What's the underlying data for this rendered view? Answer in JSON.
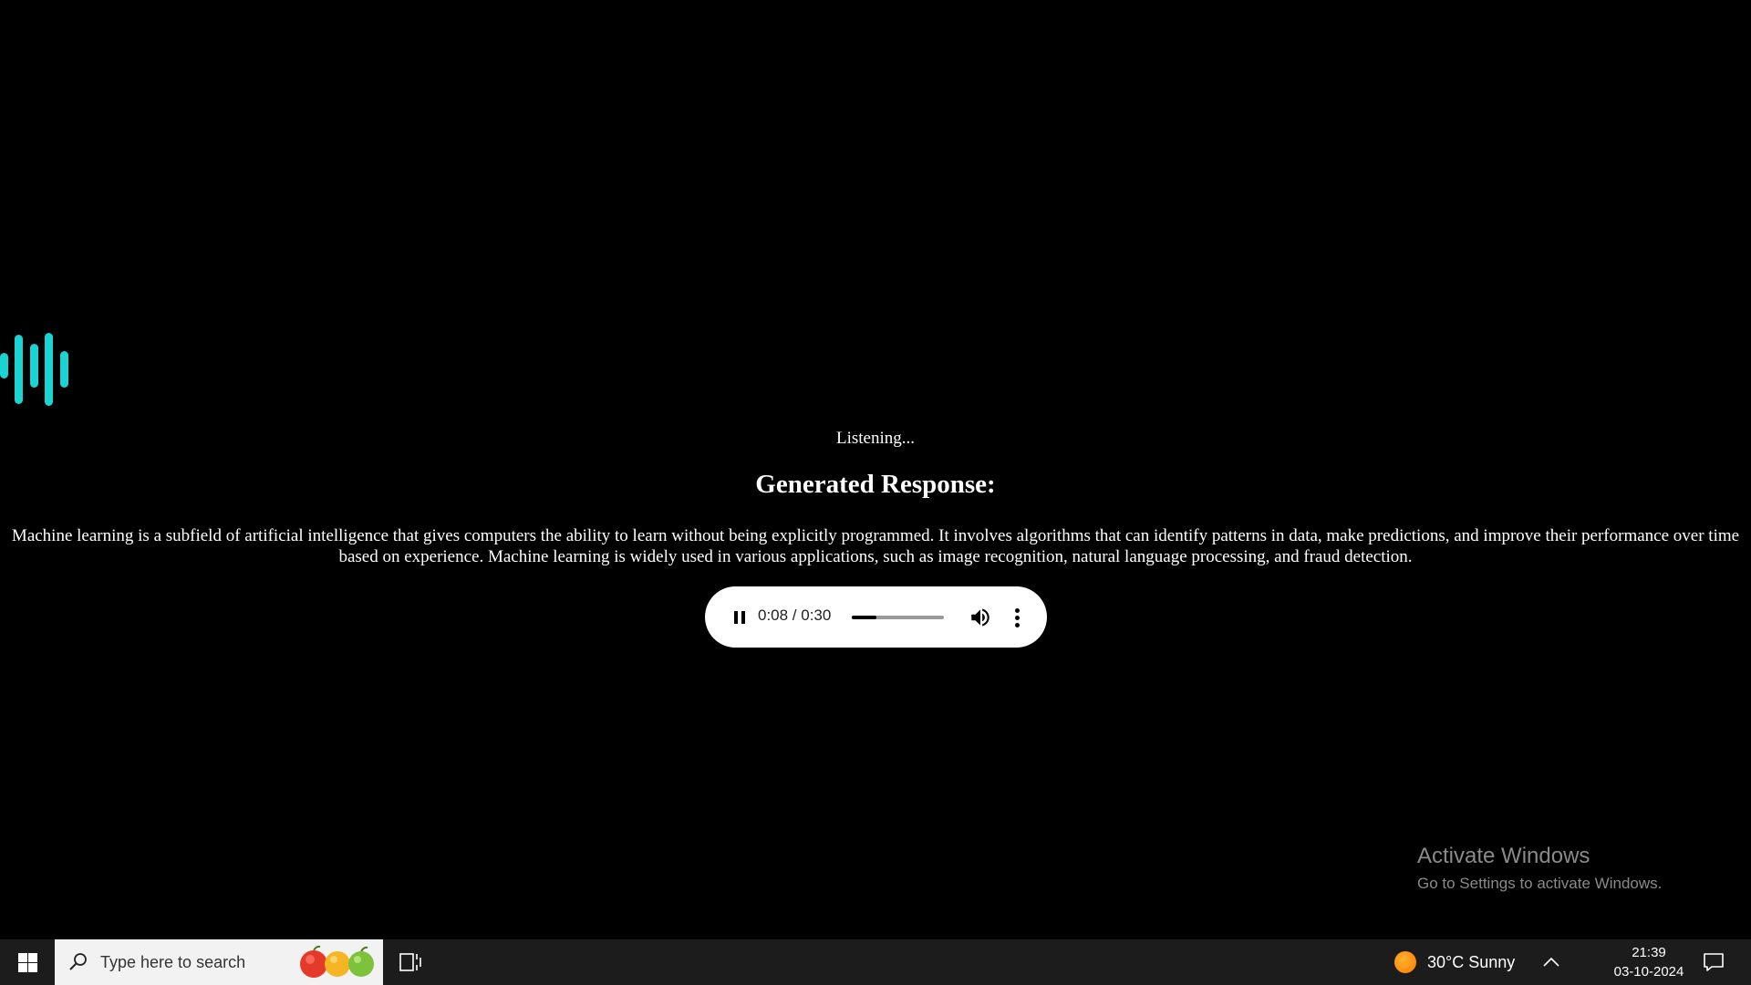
{
  "app": {
    "status_text": "Listening...",
    "heading": "Generated Response:",
    "response_text": "Machine learning is a subfield of artificial intelligence that gives computers the ability to learn without being explicitly programmed. It involves algorithms that can identify patterns in data, make predictions, and improve their performance over time based on experience. Machine learning is widely used in various applications, such as image recognition, natural language processing, and fraud detection.",
    "accent_color": "#1ad3d3"
  },
  "audio_player": {
    "state": "playing",
    "current_time": "0:08",
    "duration": "0:30",
    "time_display": "0:08 / 0:30",
    "progress_fraction": 0.27
  },
  "watermark": {
    "title": "Activate Windows",
    "subtitle": "Go to Settings to activate Windows."
  },
  "taskbar": {
    "start_icon": "windows-logo-icon",
    "search_placeholder": "Type here to search",
    "search_icon": "search-icon",
    "task_view_icon": "task-view-icon",
    "weather_temp": "30°C",
    "weather_condition": "Sunny",
    "weather_text": "30°C  Sunny",
    "time": "21:39",
    "date": "03-10-2024",
    "notification_icon": "notification-icon"
  }
}
